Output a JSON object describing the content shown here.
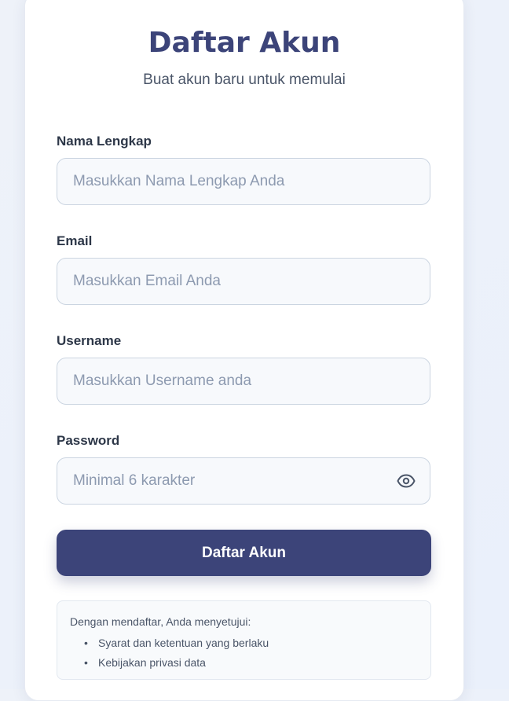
{
  "header": {
    "title": "Daftar Akun",
    "subtitle": "Buat akun baru untuk memulai"
  },
  "form": {
    "fields": [
      {
        "label": "Nama Lengkap",
        "placeholder": "Masukkan Nama Lengkap Anda",
        "value": ""
      },
      {
        "label": "Email",
        "placeholder": "Masukkan Email Anda",
        "value": ""
      },
      {
        "label": "Username",
        "placeholder": "Masukkan Username anda",
        "value": ""
      },
      {
        "label": "Password",
        "placeholder": "Minimal 6 karakter",
        "value": "",
        "icon": "eye-icon"
      }
    ],
    "submit_label": "Daftar Akun"
  },
  "terms": {
    "intro": "Dengan mendaftar, Anda menyetujui:",
    "items": [
      "Syarat dan ketentuan yang berlaku",
      "Kebijakan privasi data"
    ]
  },
  "colors": {
    "primary": "#3c4479",
    "background": "#eef2f9",
    "input_bg": "#f7f9fc",
    "input_border": "#cbd5e1",
    "placeholder": "#8d9ab0"
  }
}
